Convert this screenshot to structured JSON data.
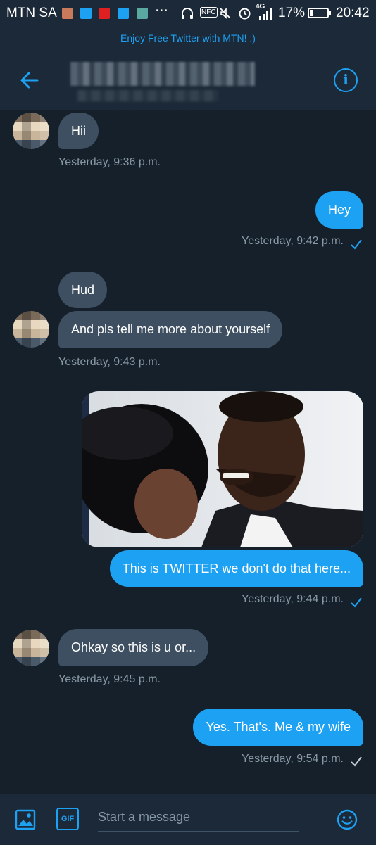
{
  "status_bar": {
    "carrier": "MTN SA",
    "more": "···",
    "nfc": "NFC",
    "network": "4G",
    "battery": "17%",
    "time": "20:42"
  },
  "promo_banner": "Enjoy Free Twitter with MTN! :)",
  "messages": [
    {
      "text": "Hii"
    },
    {
      "text": "Yesterday, 9:36 p.m."
    },
    {
      "text": "Hey"
    },
    {
      "text": "Yesterday, 9:42 p.m."
    },
    {
      "text": "Hud"
    },
    {
      "text": "And pls tell me more about yourself"
    },
    {
      "text": "Yesterday, 9:43 p.m."
    },
    {
      "text": "This is TWITTER we don't do that here..."
    },
    {
      "text": "Yesterday, 9:44 p.m."
    },
    {
      "text": "Ohkay so this is u or..."
    },
    {
      "text": "Yesterday, 9:45 p.m."
    },
    {
      "text": "Yes. That's. Me & my wife"
    },
    {
      "text": "Yesterday, 9:54 p.m."
    }
  ],
  "composer": {
    "placeholder": "Start a message",
    "gif_label": "GIF"
  },
  "colors": {
    "background": "#15202b",
    "bar": "#1c2938",
    "accent": "#1da1f2",
    "incoming_bubble": "#3d4f60",
    "muted_text": "#8899a6"
  },
  "icons": [
    "back-arrow-icon",
    "info-icon",
    "image-icon",
    "gif-icon",
    "emoji-icon",
    "sent-check-icon",
    "read-check-icon"
  ]
}
